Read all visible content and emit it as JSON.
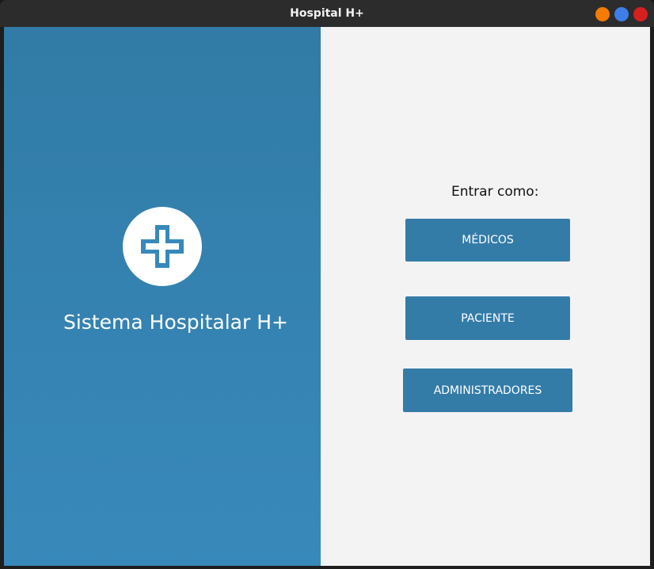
{
  "window": {
    "title": "Hospital H+",
    "controls": [
      {
        "name": "minimize",
        "color": "#f57c00"
      },
      {
        "name": "maximize",
        "color": "#3d7ee8"
      },
      {
        "name": "close",
        "color": "#d62020"
      }
    ]
  },
  "left": {
    "logo_icon": "medical-cross-icon",
    "system_name": "Sistema Hospitalar H+",
    "color": "#347ca8"
  },
  "right": {
    "enter_label": "Entrar como:",
    "buttons": [
      {
        "label": "MÉDICOS"
      },
      {
        "label": "PACIENTE"
      },
      {
        "label": "ADMINISTRADORES"
      }
    ]
  }
}
